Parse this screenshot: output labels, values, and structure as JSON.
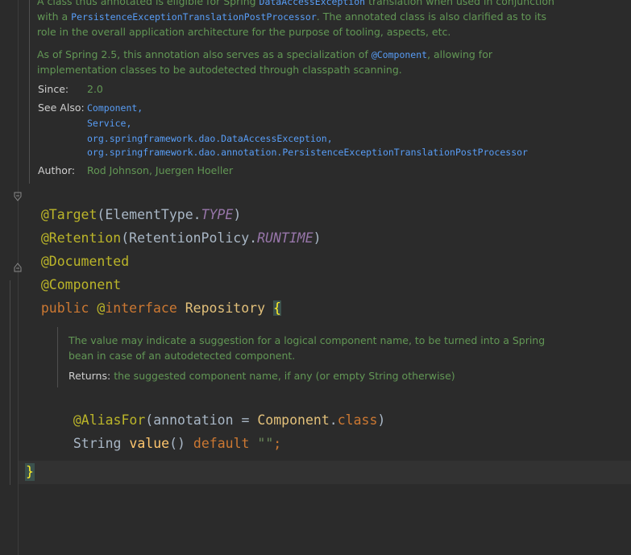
{
  "doc_top": {
    "line1_pre": "A class thus annotated is eligible for Spring ",
    "line1_ref": "DataAccessException",
    "line1_post": " translation when used in conjunction",
    "line2_pre": "with a ",
    "line2_ref": "PersistenceExceptionTranslationPostProcessor",
    "line2_post": ". The annotated class is also clarified as to its",
    "line3": "role in the overall application architecture for the purpose of tooling, aspects, etc.",
    "line4_pre": "As of Spring 2.5, this annotation also serves as a specialization of ",
    "line4_ref": "@Component",
    "line4_post": ", allowing for",
    "line5": "implementation classes to be autodetected through classpath scanning.",
    "since_label": "Since:",
    "since_value": "2.0",
    "see_also_label": "See Also:",
    "see_also": [
      "Component,",
      "Service,",
      "org.springframework.dao.DataAccessException,",
      "org.springframework.dao.annotation.PersistenceExceptionTranslationPostProcessor"
    ],
    "author_label": "Author:",
    "author_value": "Rod Johnson, Juergen Hoeller"
  },
  "code": {
    "target_anno": "@Target",
    "target_open": "(ElementType.",
    "target_const": "TYPE",
    "target_close": ")",
    "retention_anno": "@Retention",
    "retention_open": "(RetentionPolicy.",
    "retention_const": "RUNTIME",
    "retention_close": ")",
    "documented_anno": "@Documented",
    "component_anno": "@Component",
    "decl_public": "public ",
    "decl_at": "@",
    "decl_interface": "interface ",
    "decl_name": "Repository",
    "decl_space": " ",
    "decl_brace": "{",
    "aliasfor_anno": "@AliasFor",
    "aliasfor_open": "(annotation = ",
    "aliasfor_cls": "Component",
    "aliasfor_dot": ".",
    "aliasfor_kw": "class",
    "aliasfor_close": ")",
    "value_type": "String ",
    "value_method": "value",
    "value_parens": "() ",
    "value_default": "default ",
    "value_str": "\"\"",
    "value_semi": ";",
    "close_brace": "}"
  },
  "doc_inner": {
    "line1": "The value may indicate a suggestion for a logical component name, to be turned into a Spring",
    "line2": "bean in case of an autodetected component.",
    "returns_label": "Returns:",
    "returns_value": " the suggested component name, if any (or empty String otherwise)"
  },
  "colors": {
    "background": "#2b2b2b",
    "doc_text": "#629755",
    "annotation": "#bbb529",
    "keyword": "#cc7832",
    "link": "#589df6"
  }
}
